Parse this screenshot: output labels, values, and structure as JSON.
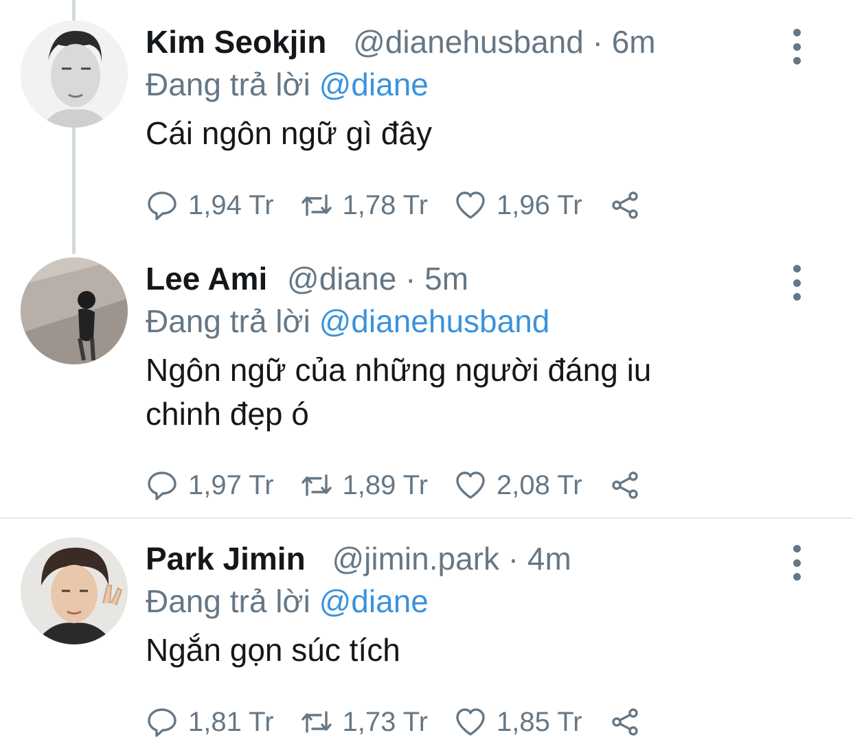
{
  "tweets": [
    {
      "name": "Kim Seokjin",
      "handle": "@dianehusband",
      "time": "· 6m",
      "reply_prefix": "Đang trả lời",
      "reply_mention": "@diane",
      "text": "Cái ngôn ngữ gì đây",
      "replies": "1,94 Tr",
      "retweets": "1,78 Tr",
      "likes": "1,96 Tr"
    },
    {
      "name": "Lee Ami",
      "handle": "@diane",
      "time": "· 5m",
      "reply_prefix": "Đang trả lời",
      "reply_mention": "@dianehusband",
      "text_line1": "Ngôn ngữ của những người đáng iu",
      "text_line2": "chinh đẹp ó",
      "replies": "1,97 Tr",
      "retweets": "1,89 Tr",
      "likes": "2,08 Tr"
    },
    {
      "name": "Park Jimin",
      "handle": "@jimin.park",
      "time": "· 4m",
      "reply_prefix": "Đang trả lời",
      "reply_mention": "@diane",
      "text": "Ngắn gọn súc tích",
      "replies": "1,81 Tr",
      "retweets": "1,73 Tr",
      "likes": "1,85 Tr"
    }
  ],
  "icons": {
    "reply": "reply-icon",
    "retweet": "retweet-icon",
    "like": "heart-icon",
    "share": "share-icon",
    "more": "more-options-icon"
  },
  "colors": {
    "text": "#14171a",
    "secondary": "#657786",
    "mention": "#3a93dd",
    "divider": "#e6ecf0"
  }
}
